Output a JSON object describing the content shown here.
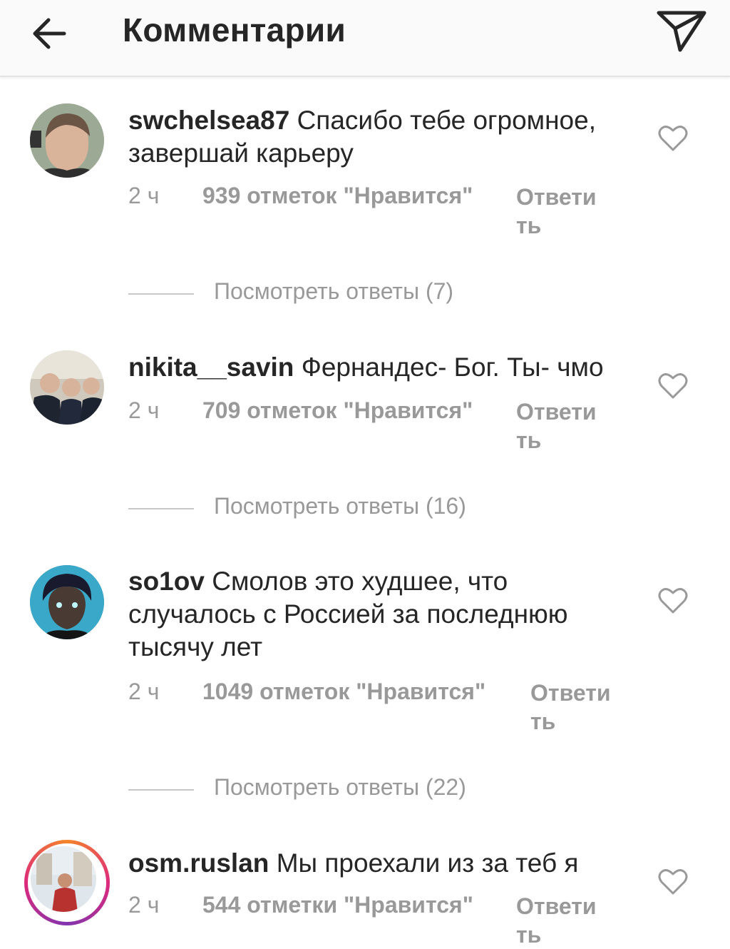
{
  "header": {
    "title": "Комментарии",
    "back_icon": "arrow-left-icon",
    "send_icon": "paper-plane-icon"
  },
  "comments": [
    {
      "username": "swchelsea87",
      "text": "Спасибо тебе огромное, завершай карьеру",
      "time": "2 ч",
      "likes": "939 отметок \"Нравится\"",
      "reply": "Ответить",
      "view_replies": "Посмотреть ответы (7)"
    },
    {
      "username": "nikita__savin",
      "text": "Фернандес- Бог. Ты- чмо",
      "time": "2 ч",
      "likes": "709 отметок \"Нравится\"",
      "reply": "Ответить",
      "view_replies": "Посмотреть ответы (16)"
    },
    {
      "username": "so1ov",
      "text": "Смолов это худшее, что случалось с Россией за последнюю тысячу лет",
      "time": "2 ч",
      "likes": "1049 отметок \"Нравится\"",
      "reply": "Ответить",
      "view_replies": "Посмотреть ответы (22)"
    },
    {
      "username": "osm.ruslan",
      "text": "Мы проехали из за теб я",
      "time": "2 ч",
      "likes": "544 отметки \"Нравится\"",
      "reply": "Ответить"
    }
  ],
  "colors": {
    "text": "#262626",
    "secondary": "#999999",
    "divider": "#c7c7c7",
    "header_bg": "#fafafa"
  }
}
